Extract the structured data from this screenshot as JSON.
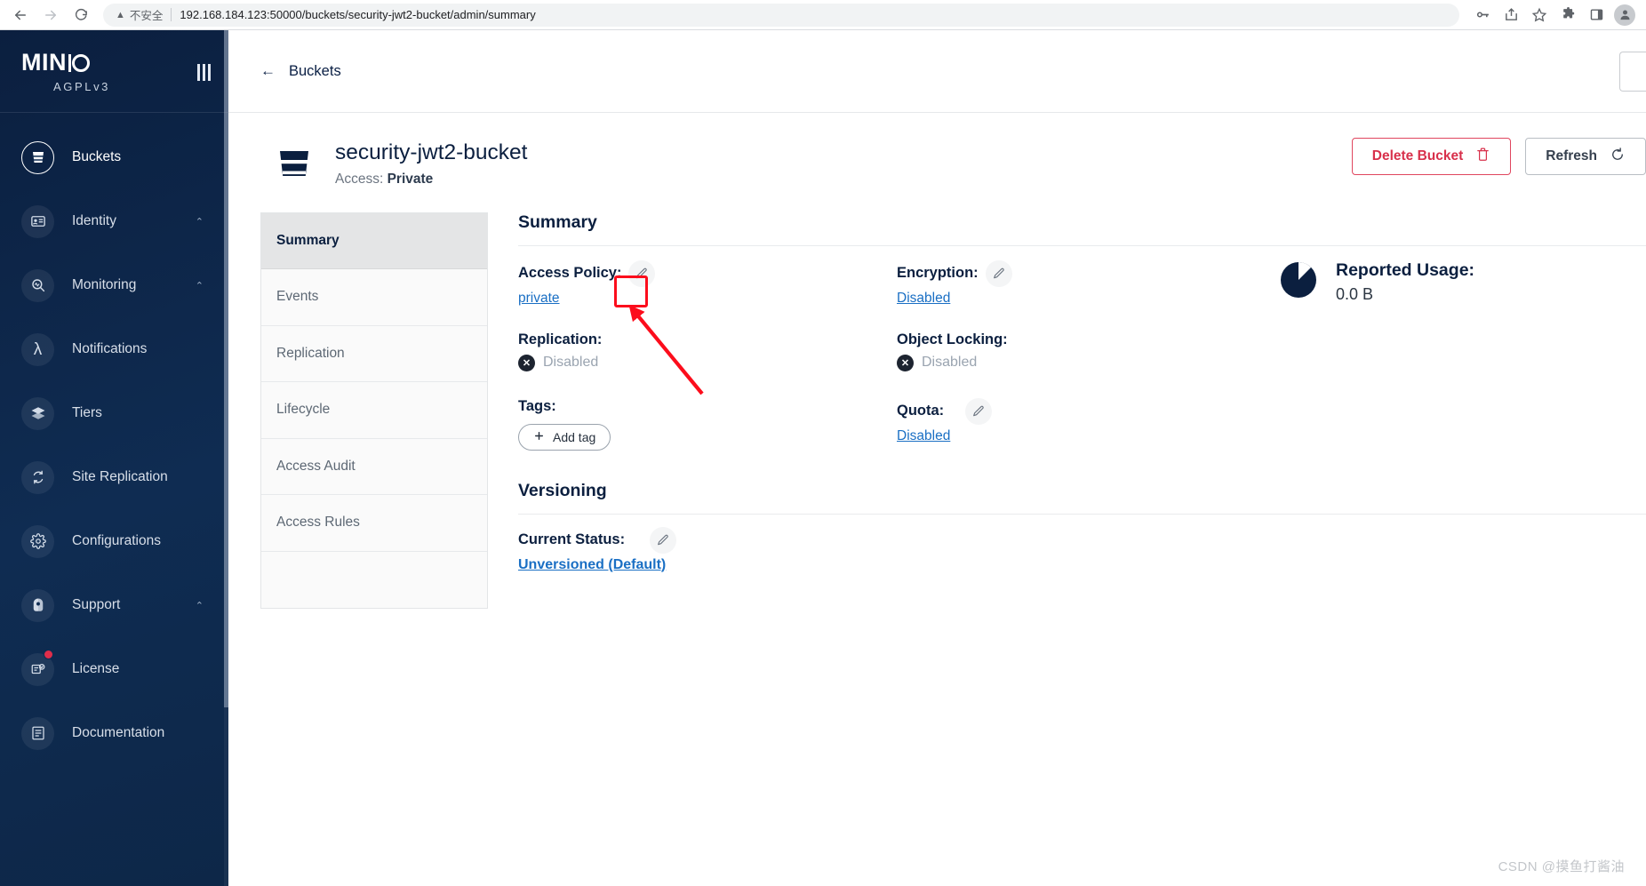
{
  "browser": {
    "back_icon": "back-arrow-icon",
    "forward_icon": "forward-arrow-icon",
    "reload_icon": "reload-icon",
    "security_warning": "不安全",
    "url": "192.168.184.123:50000/buckets/security-jwt2-bucket/admin/summary",
    "toolbar_icons": [
      "password-key-icon",
      "share-icon",
      "bookmark-star-icon",
      "extensions-puzzle-icon",
      "side-panel-icon",
      "profile-avatar-icon"
    ]
  },
  "sidebar": {
    "logo": "MINIO",
    "logo_sub": "AGPLv3",
    "menu_icon": "hamburger-menu-icon",
    "items": [
      {
        "label": "Buckets",
        "icon": "bucket-icon",
        "active": true,
        "chevron": "",
        "badge": false
      },
      {
        "label": "Identity",
        "icon": "identity-card-icon",
        "active": false,
        "chevron": "⌃",
        "badge": false
      },
      {
        "label": "Monitoring",
        "icon": "monitoring-icon",
        "active": false,
        "chevron": "⌃",
        "badge": false
      },
      {
        "label": "Notifications",
        "icon": "lambda-icon",
        "active": false,
        "chevron": "",
        "badge": false
      },
      {
        "label": "Tiers",
        "icon": "layers-icon",
        "active": false,
        "chevron": "",
        "badge": false
      },
      {
        "label": "Site Replication",
        "icon": "site-replication-icon",
        "active": false,
        "chevron": "",
        "badge": false
      },
      {
        "label": "Configurations",
        "icon": "gear-icon",
        "active": false,
        "chevron": "",
        "badge": false
      },
      {
        "label": "Support",
        "icon": "support-icon",
        "active": false,
        "chevron": "⌃",
        "badge": false
      },
      {
        "label": "License",
        "icon": "license-icon",
        "active": false,
        "chevron": "",
        "badge": true
      },
      {
        "label": "Documentation",
        "icon": "documentation-icon",
        "active": false,
        "chevron": "",
        "badge": false
      }
    ]
  },
  "header": {
    "back_label": "Buckets",
    "back_icon": "back-arrow-icon"
  },
  "bucket": {
    "name": "security-jwt2-bucket",
    "access_label": "Access:",
    "access_value": "Private",
    "icon": "bucket-icon"
  },
  "actions": {
    "delete_label": "Delete Bucket",
    "delete_icon": "trash-icon",
    "refresh_label": "Refresh",
    "refresh_icon": "refresh-icon"
  },
  "tabs": [
    {
      "label": "Summary",
      "active": true
    },
    {
      "label": "Events",
      "active": false
    },
    {
      "label": "Replication",
      "active": false
    },
    {
      "label": "Lifecycle",
      "active": false
    },
    {
      "label": "Access Audit",
      "active": false
    },
    {
      "label": "Access Rules",
      "active": false
    }
  ],
  "summary": {
    "title": "Summary",
    "access_policy": {
      "label": "Access Policy:",
      "value": "private",
      "edit_icon": "pencil-edit-icon"
    },
    "replication": {
      "label": "Replication:",
      "value": "Disabled",
      "status_icon": "x-circle-icon"
    },
    "tags": {
      "label": "Tags:",
      "add_label": "Add tag",
      "add_icon": "plus-icon"
    },
    "encryption": {
      "label": "Encryption:",
      "value": "Disabled",
      "edit_icon": "pencil-edit-icon"
    },
    "object_locking": {
      "label": "Object Locking:",
      "value": "Disabled",
      "status_icon": "x-circle-icon"
    },
    "quota": {
      "label": "Quota:",
      "value": "Disabled",
      "edit_icon": "pencil-edit-icon"
    },
    "reported_usage": {
      "label": "Reported Usage:",
      "value": "0.0 B",
      "chart_icon": "pie-chart-icon"
    }
  },
  "versioning": {
    "title": "Versioning",
    "status_label": "Current Status:",
    "status_value": "Unversioned (Default)",
    "edit_icon": "pencil-edit-icon"
  },
  "watermark": "CSDN @摸鱼打酱油",
  "colors": {
    "brand_navy": "#0b1f3f",
    "danger_red": "#d8304b",
    "link_blue": "#1a6fc4",
    "annotation_red": "#fc0d1c",
    "badge_red": "#e02d4a"
  }
}
